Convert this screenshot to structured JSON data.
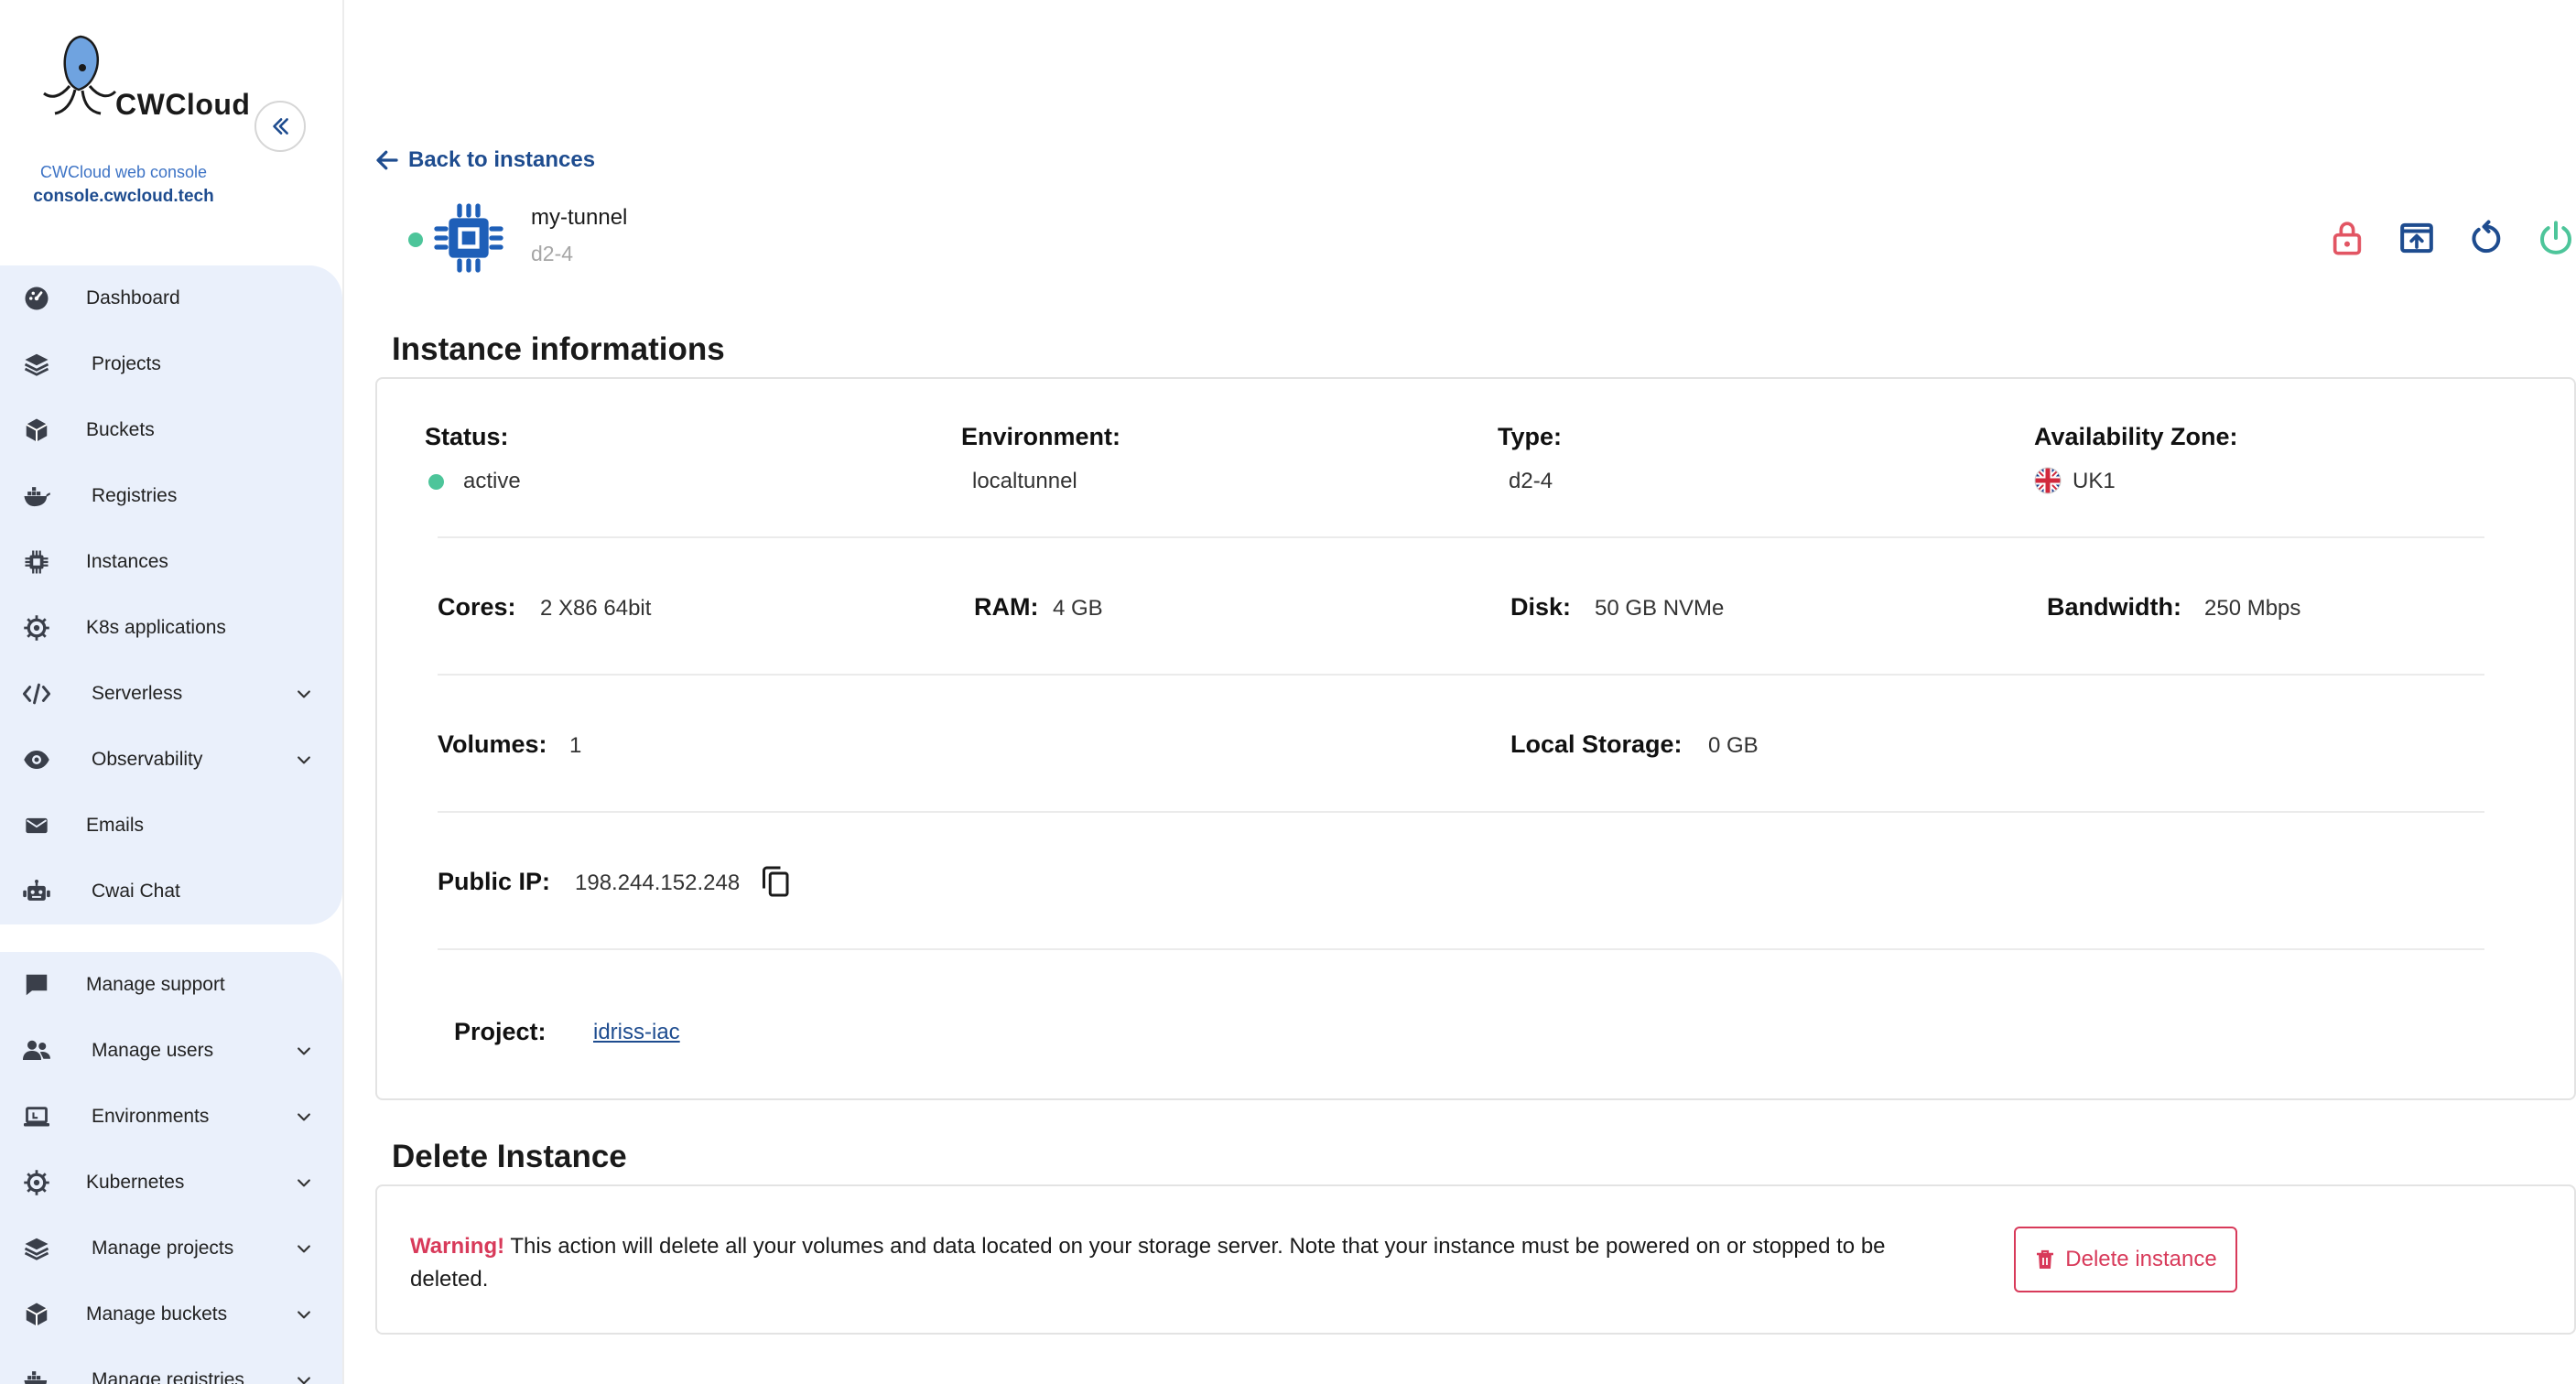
{
  "app": {
    "logo_text": "CWCloud",
    "console_label": "CWCloud web console",
    "console_url": "console.cwcloud.tech"
  },
  "sidebar": {
    "group1": [
      {
        "label": "Dashboard",
        "icon": "dashboard-icon"
      },
      {
        "label": "Projects",
        "icon": "layers-icon"
      },
      {
        "label": "Buckets",
        "icon": "box-icon"
      },
      {
        "label": "Registries",
        "icon": "docker-icon"
      },
      {
        "label": "Instances",
        "icon": "chip-icon"
      },
      {
        "label": "K8s applications",
        "icon": "helm-icon"
      },
      {
        "label": "Serverless",
        "icon": "code-icon",
        "expandable": true
      },
      {
        "label": "Observability",
        "icon": "eye-icon",
        "expandable": true
      },
      {
        "label": "Emails",
        "icon": "envelope-icon"
      },
      {
        "label": "Cwai Chat",
        "icon": "robot-icon"
      }
    ],
    "group2": [
      {
        "label": "Manage support",
        "icon": "chat-bubble-icon"
      },
      {
        "label": "Manage users",
        "icon": "users-icon",
        "expandable": true
      },
      {
        "label": "Environments",
        "icon": "laptop-icon",
        "expandable": true
      },
      {
        "label": "Kubernetes",
        "icon": "helm-icon",
        "expandable": true
      },
      {
        "label": "Manage projects",
        "icon": "layers-icon",
        "expandable": true
      },
      {
        "label": "Manage buckets",
        "icon": "box-icon",
        "expandable": true
      },
      {
        "label": "Manage registries",
        "icon": "docker-icon",
        "expandable": true
      }
    ]
  },
  "back_label": "Back to instances",
  "instance": {
    "name": "my-tunnel",
    "type": "d2-4"
  },
  "info": {
    "title": "Instance informations",
    "status_label": "Status:",
    "status_value": "active",
    "environment_label": "Environment:",
    "environment_value": "localtunnel",
    "type_label": "Type:",
    "type_value": "d2-4",
    "zone_label": "Availability Zone:",
    "zone_value": "UK1",
    "cores_label": "Cores:",
    "cores_value": "2 X86 64bit",
    "ram_label": "RAM:",
    "ram_value": "4 GB",
    "disk_label": "Disk:",
    "disk_value": "50 GB NVMe",
    "bandwidth_label": "Bandwidth:",
    "bandwidth_value": "250 Mbps",
    "volumes_label": "Volumes:",
    "volumes_value": "1",
    "local_storage_label": "Local Storage:",
    "local_storage_value": "0 GB",
    "ip_label": "Public IP:",
    "ip_value": "198.244.152.248",
    "project_label": "Project:",
    "project_value": "idriss-iac"
  },
  "delete": {
    "title": "Delete Instance",
    "warning_prefix": "Warning!",
    "warning_text": " This action will delete all your volumes and data located on your storage server. Note that your instance must be powered on or stopped to be deleted.",
    "button_label": "Delete instance"
  },
  "colors": {
    "accent": "#1e4c8f",
    "danger": "#d83a5a",
    "success": "#4dc59a",
    "sidebar_bg": "#eaf0fb"
  }
}
